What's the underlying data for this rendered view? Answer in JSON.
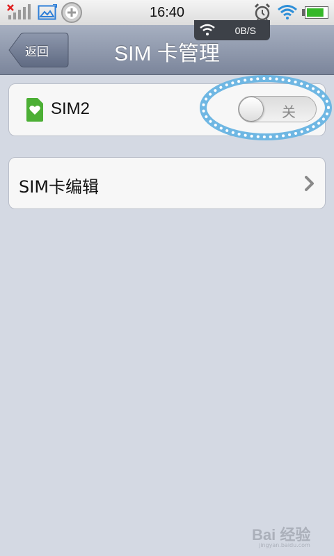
{
  "status_bar": {
    "time": "16:40",
    "net_speed": "0B/S",
    "icons": [
      "no-sim-signal-icon",
      "image-notification-icon",
      "add-circle-icon",
      "alarm-icon",
      "wifi-icon",
      "battery-icon"
    ],
    "battery_level": 0.85
  },
  "nav": {
    "back_label": "返回",
    "title": "SIM 卡管理"
  },
  "sim_card": {
    "label": "SIM2",
    "icon": "sim-card-icon",
    "icon_color": "#4caf35",
    "toggle_state": "关",
    "toggle_on": false
  },
  "edit_card": {
    "label": "SIM卡编辑",
    "icon": "chevron-right-icon"
  },
  "watermark": {
    "brand": "Bai 经验",
    "url": "jingyan.baidu.com"
  },
  "colors": {
    "background": "#d4d9e3",
    "nav_top": "#a7b0c1",
    "nav_bottom": "#7b859b",
    "highlight": "#6fb7e3"
  }
}
